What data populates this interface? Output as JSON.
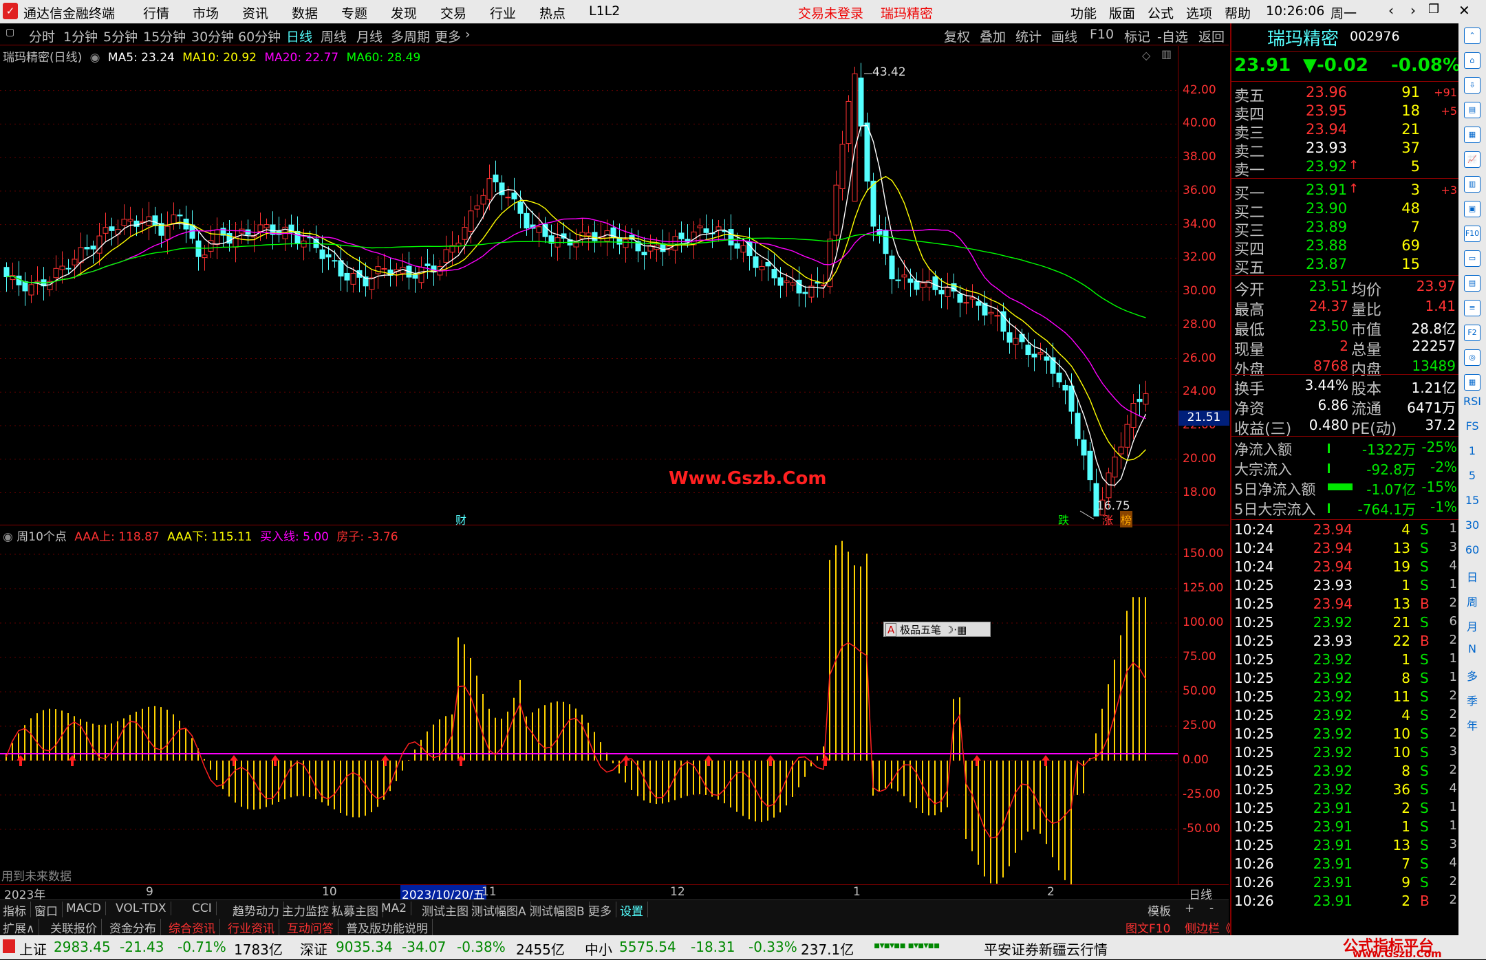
{
  "menubar": {
    "app_title": "通达信金融终端",
    "items": [
      "行情",
      "市场",
      "资讯",
      "数据",
      "专题",
      "发现",
      "交易",
      "行业",
      "热点",
      "L1L2"
    ],
    "trade_status": "交易未登录",
    "stock_name": "瑞玛精密",
    "right_items": [
      "功能",
      "版面",
      "公式",
      "选项",
      "帮助"
    ],
    "clock": "10:26:06",
    "weekday": "周一"
  },
  "periods": [
    "分时",
    "1分钟",
    "5分钟",
    "15分钟",
    "30分钟",
    "60分钟",
    "日线",
    "周线",
    "月线",
    "多周期",
    "更多"
  ],
  "active_period": "日线",
  "toolbar_right": [
    "复权",
    "叠加",
    "统计",
    "画线",
    "F10",
    "标记",
    "-自选",
    "返回"
  ],
  "main": {
    "label": "瑞玛精密(日线)",
    "ma": [
      {
        "t": "MA5: 23.24",
        "c": "#ffffff"
      },
      {
        "t": "MA10: 20.92",
        "c": "#ffff00"
      },
      {
        "t": "MA20: 22.77",
        "c": "#ff00ff"
      },
      {
        "t": "MA60: 28.49",
        "c": "#00ff00"
      }
    ],
    "high_label": "43.42",
    "low_label": "16.75",
    "watermark": "Www.Gszb.Com",
    "price_tag": "21.51",
    "marks": [
      {
        "t": "财",
        "c": "#5ff"
      },
      {
        "t": "跌",
        "c": "#0f0"
      },
      {
        "t": "涨",
        "c": "#f33"
      },
      {
        "t": "榜",
        "c": "#fa0"
      }
    ]
  },
  "sub": {
    "label": "周10个点",
    "params": [
      {
        "t": "AAA上: 118.87",
        "c": "#ff3232"
      },
      {
        "t": "AAA下: 115.11",
        "c": "#ffff00"
      },
      {
        "t": "买入线: 5.00",
        "c": "#ff00ff"
      },
      {
        "t": "房子: -3.76",
        "c": "#ff3232"
      }
    ],
    "note": "用到未来数据",
    "ime": "极品五笔"
  },
  "chart_data": [
    {
      "type": "candlestick",
      "title": "瑞玛精密(日线)",
      "ylim": [
        16.75,
        43.42
      ],
      "y_ticks": [
        18,
        20,
        22,
        24,
        26,
        28,
        30,
        32,
        34,
        36,
        38,
        40,
        42
      ],
      "high": 43.42,
      "low": 16.75,
      "last": 23.91,
      "series": [
        {
          "name": "MA5",
          "value": 23.24
        },
        {
          "name": "MA10",
          "value": 20.92
        },
        {
          "name": "MA20",
          "value": 22.77
        },
        {
          "name": "MA60",
          "value": 28.49
        }
      ],
      "x_labels": [
        "2023年",
        "9",
        "10",
        "2023/10/20/五",
        "11",
        "12",
        "1",
        "2",
        "日线"
      ]
    },
    {
      "type": "bar",
      "title": "周10个点",
      "ylim": [
        -50,
        150
      ],
      "y_ticks": [
        150,
        125,
        100,
        75,
        50,
        25,
        0,
        -25,
        -50
      ],
      "series": [
        {
          "name": "AAA上",
          "value": 118.87
        },
        {
          "name": "AAA下",
          "value": 115.11
        },
        {
          "name": "买入线",
          "value": 5.0
        },
        {
          "name": "房子",
          "value": -3.76
        }
      ]
    }
  ],
  "bottom_tabs": [
    "指标",
    "窗口",
    "MACD",
    "VOL-TDX",
    "CCI",
    "趋势动力",
    "主力监控",
    "私募主图",
    "MA2",
    "测试主图",
    "测试幅图A",
    "测试幅图B",
    "更多",
    "设置"
  ],
  "bottom_tabs_right": [
    "模板",
    "+",
    "-"
  ],
  "bottom_tabs2": [
    "扩展∧",
    "关联报价",
    "资金分布",
    "综合资讯",
    "行业资讯",
    "互动问答",
    "普及版功能说明"
  ],
  "bottom_tabs2_right": [
    "图文F10",
    "侧边栏《",
    "笔",
    "价",
    "细",
    "势"
  ],
  "status": {
    "sh": {
      "name": "上证",
      "v": "2983.45",
      "c": "-21.43",
      "p": "-0.71%",
      "amt": "1783亿"
    },
    "sz": {
      "name": "深证",
      "v": "9035.34",
      "c": "-34.07",
      "p": "-0.38%",
      "amt": "2455亿"
    },
    "zx": {
      "name": "中小",
      "v": "5575.54",
      "c": "-18.31",
      "p": "-0.33%",
      "amt": "237.1亿"
    },
    "broker": "平安证券新疆云行情",
    "brand": "公式指标平台",
    "brand_url": "www.Gszb.Com"
  },
  "quote": {
    "name": "瑞玛精密",
    "code": "002976",
    "price": "23.91",
    "change": "▼-0.02",
    "pct": "-0.08%",
    "asks": [
      {
        "l": "卖五",
        "p": "23.96",
        "v": "91",
        "d": "+91"
      },
      {
        "l": "卖四",
        "p": "23.95",
        "v": "18",
        "d": "+5"
      },
      {
        "l": "卖三",
        "p": "23.94",
        "v": "21",
        "d": ""
      },
      {
        "l": "卖二",
        "p": "23.93",
        "v": "37",
        "d": ""
      },
      {
        "l": "卖一",
        "p": "23.92",
        "v": "5",
        "d": ""
      }
    ],
    "bids": [
      {
        "l": "买一",
        "p": "23.91",
        "v": "3",
        "d": "+3"
      },
      {
        "l": "买二",
        "p": "23.90",
        "v": "48",
        "d": ""
      },
      {
        "l": "买三",
        "p": "23.89",
        "v": "7",
        "d": ""
      },
      {
        "l": "买四",
        "p": "23.88",
        "v": "69",
        "d": ""
      },
      {
        "l": "买五",
        "p": "23.87",
        "v": "15",
        "d": ""
      }
    ],
    "stats": [
      [
        "今开",
        "23.51",
        "均价",
        "23.97"
      ],
      [
        "最高",
        "24.37",
        "量比",
        "1.41"
      ],
      [
        "最低",
        "23.50",
        "市值",
        "28.8亿"
      ],
      [
        "现量",
        "2",
        "总量",
        "22257"
      ],
      [
        "外盘",
        "8768",
        "内盘",
        "13489"
      ]
    ],
    "stats2": [
      [
        "换手",
        "3.44%",
        "股本",
        "1.21亿"
      ],
      [
        "净资",
        "6.86",
        "流通",
        "6471万"
      ],
      [
        "收益(三)",
        "0.480",
        "PE(动)",
        "37.2"
      ]
    ],
    "flows": [
      [
        "净流入额",
        "-1322万",
        "-25%"
      ],
      [
        "大宗流入",
        "-92.8万",
        "-2%"
      ],
      [
        "5日净流入额",
        "-1.07亿",
        "-15%"
      ],
      [
        "5日大宗流入",
        "-764.1万",
        "-1%"
      ]
    ],
    "ticks": [
      [
        "10:24",
        "23.94",
        "4",
        "S",
        "1"
      ],
      [
        "10:24",
        "23.94",
        "13",
        "S",
        "3"
      ],
      [
        "10:24",
        "23.94",
        "19",
        "S",
        "4"
      ],
      [
        "10:25",
        "23.93",
        "1",
        "S",
        "1"
      ],
      [
        "10:25",
        "23.94",
        "13",
        "B",
        "2"
      ],
      [
        "10:25",
        "23.92",
        "21",
        "S",
        "6"
      ],
      [
        "10:25",
        "23.93",
        "22",
        "B",
        "2"
      ],
      [
        "10:25",
        "23.92",
        "1",
        "S",
        "1"
      ],
      [
        "10:25",
        "23.92",
        "8",
        "S",
        "1"
      ],
      [
        "10:25",
        "23.92",
        "11",
        "S",
        "2"
      ],
      [
        "10:25",
        "23.92",
        "4",
        "S",
        "2"
      ],
      [
        "10:25",
        "23.92",
        "10",
        "S",
        "2"
      ],
      [
        "10:25",
        "23.92",
        "10",
        "S",
        "3"
      ],
      [
        "10:25",
        "23.92",
        "8",
        "S",
        "2"
      ],
      [
        "10:25",
        "23.92",
        "36",
        "S",
        "4"
      ],
      [
        "10:25",
        "23.91",
        "2",
        "S",
        "1"
      ],
      [
        "10:25",
        "23.91",
        "1",
        "S",
        "1"
      ],
      [
        "10:25",
        "23.91",
        "13",
        "S",
        "3"
      ],
      [
        "10:26",
        "23.91",
        "7",
        "S",
        "4"
      ],
      [
        "10:26",
        "23.91",
        "9",
        "S",
        "2"
      ],
      [
        "10:26",
        "23.91",
        "2",
        "B",
        "2"
      ]
    ]
  },
  "side_icons": [
    "RSI",
    "FS",
    "1",
    "5",
    "15",
    "30",
    "60",
    "日",
    "周",
    "月",
    "N",
    "多",
    "季",
    "年"
  ]
}
